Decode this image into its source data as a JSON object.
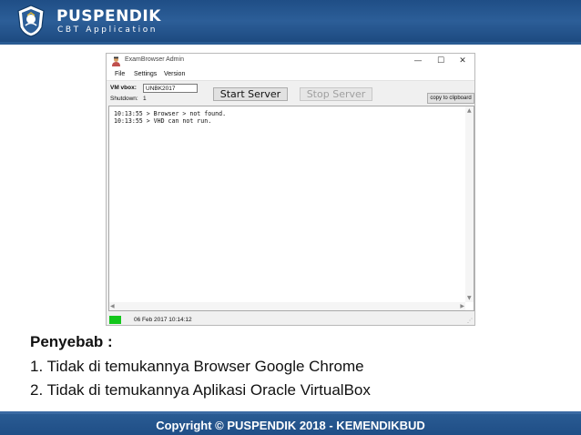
{
  "header": {
    "brand_name": "PUSPENDIK",
    "brand_sub": "CBT Application"
  },
  "window": {
    "title": "ExamBrowser Admin",
    "controls": {
      "minimize": "—",
      "maximize": "☐",
      "close": "✕"
    },
    "menu": [
      "File",
      "Settings",
      "Version"
    ],
    "vm_label": "VM vbox:",
    "vm_value": "UNBK2017",
    "shutdown_label": "Shutdown:",
    "shutdown_value": "1",
    "start_button": "Start Server",
    "stop_button": "Stop Server",
    "copy_button": "copy to clipboard",
    "log_lines": [
      "10:13:55 > Browser > not found.",
      "10:13:55 > VHD can not run."
    ],
    "status_time": "06 Feb 2017 10:14:12",
    "status_led_color": "#13c61b"
  },
  "cause": {
    "title": "Penyebab  :",
    "items": [
      "1. Tidak di temukannya Browser Google Chrome",
      "2. Tidak di temukannya Aplikasi Oracle VirtualBox"
    ]
  },
  "footer": {
    "copyright": "Copyright © PUSPENDIK 2018 - KEMENDIKBUD"
  },
  "colors": {
    "header_blue": "#1f4e86",
    "accent_blue": "#2c5e98"
  }
}
